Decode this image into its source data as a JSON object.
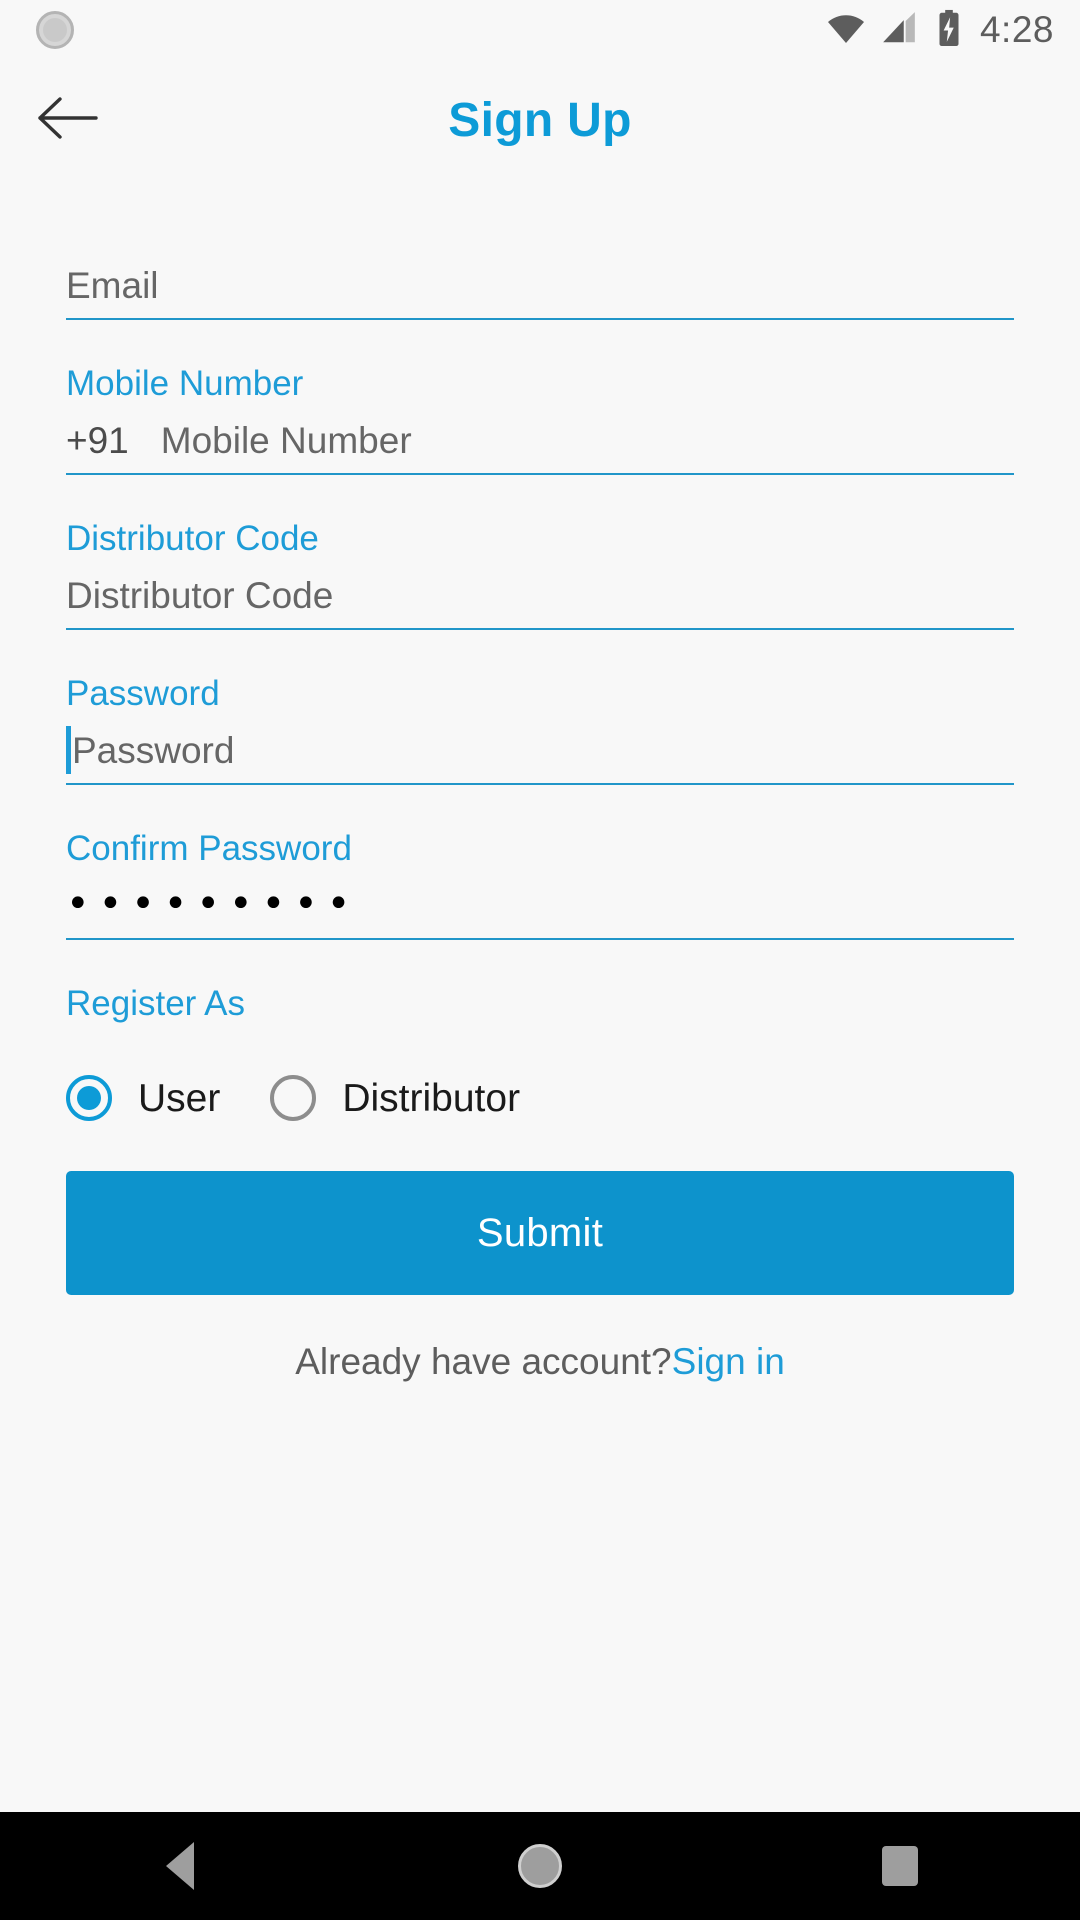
{
  "status_bar": {
    "time": "4:28",
    "icons": {
      "notification": "sync-circle-icon",
      "wifi": "wifi-icon",
      "signal": "cellular-signal-icon",
      "battery": "battery-charging-icon"
    }
  },
  "app_bar": {
    "back_icon": "arrow-left-icon",
    "title": "Sign Up",
    "title_color": "#0d9bd7"
  },
  "form": {
    "fields": [
      {
        "id": "email",
        "label": "",
        "placeholder": "Email",
        "value": "",
        "prefix": "",
        "type": "email"
      },
      {
        "id": "mobile",
        "label": "Mobile Number",
        "placeholder": "Mobile Number",
        "value": "",
        "prefix": "+91",
        "type": "tel"
      },
      {
        "id": "distributor_code",
        "label": "Distributor Code",
        "placeholder": "Distributor Code",
        "value": "",
        "prefix": "",
        "type": "text"
      },
      {
        "id": "password",
        "label": "Password",
        "placeholder": "Password",
        "value": "",
        "prefix": "",
        "type": "password",
        "focused": true
      },
      {
        "id": "confirm_password",
        "label": "Confirm Password",
        "placeholder": "Confirm Password",
        "value": "•••••••••",
        "prefix": "",
        "type": "password"
      }
    ],
    "register_as": {
      "label": "Register As",
      "options": [
        {
          "id": "user",
          "label": "User",
          "selected": true
        },
        {
          "id": "distributor",
          "label": "Distributor",
          "selected": false
        }
      ]
    },
    "submit_label": "Submit",
    "footer": {
      "text": "Already have account?",
      "link": "Sign in"
    }
  },
  "nav_bar": {
    "back": "nav-back-icon",
    "home": "nav-home-icon",
    "recents": "nav-recents-icon"
  },
  "colors": {
    "accent": "#0d9bd7",
    "underline": "#2196c9",
    "button": "#0d93cc",
    "background": "#f8f8f8",
    "nav_background": "#000000"
  }
}
